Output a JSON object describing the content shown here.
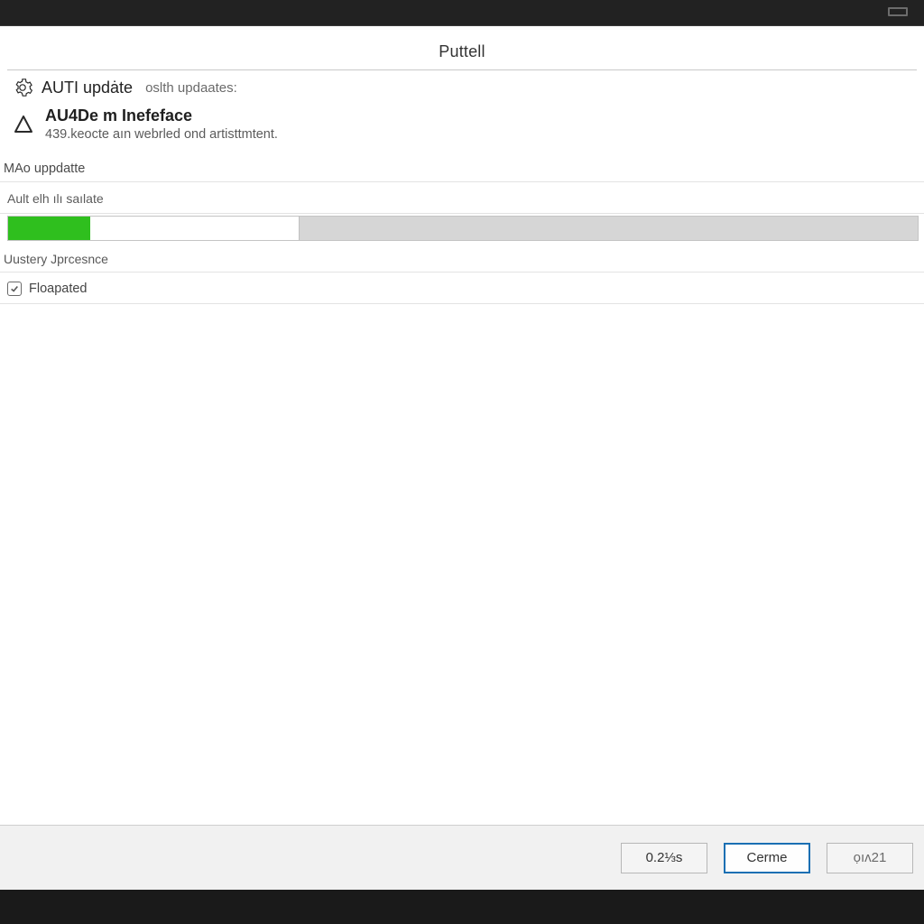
{
  "window": {
    "title": "Puttell"
  },
  "header": {
    "line1_title": "AUTI updȧte",
    "line1_sub": "oslth updaates:",
    "line2_title": "AU4De m Inefeface",
    "line2_sub": "439.keocte aın webrled ond artisttmtent."
  },
  "sections": {
    "mo_update": "MAo uppdatte",
    "sub_update": "Ault elh ılı saılate",
    "user_presence": "Uustery Jprcesnce"
  },
  "progress": {
    "fill_percent": 9,
    "buffer_percent": 32
  },
  "checkbox": {
    "label": "Floapated",
    "checked": true
  },
  "footer": {
    "btn_left": "0.2⅓s",
    "btn_middle": "Cerme",
    "btn_right": "ọıʌ21"
  }
}
